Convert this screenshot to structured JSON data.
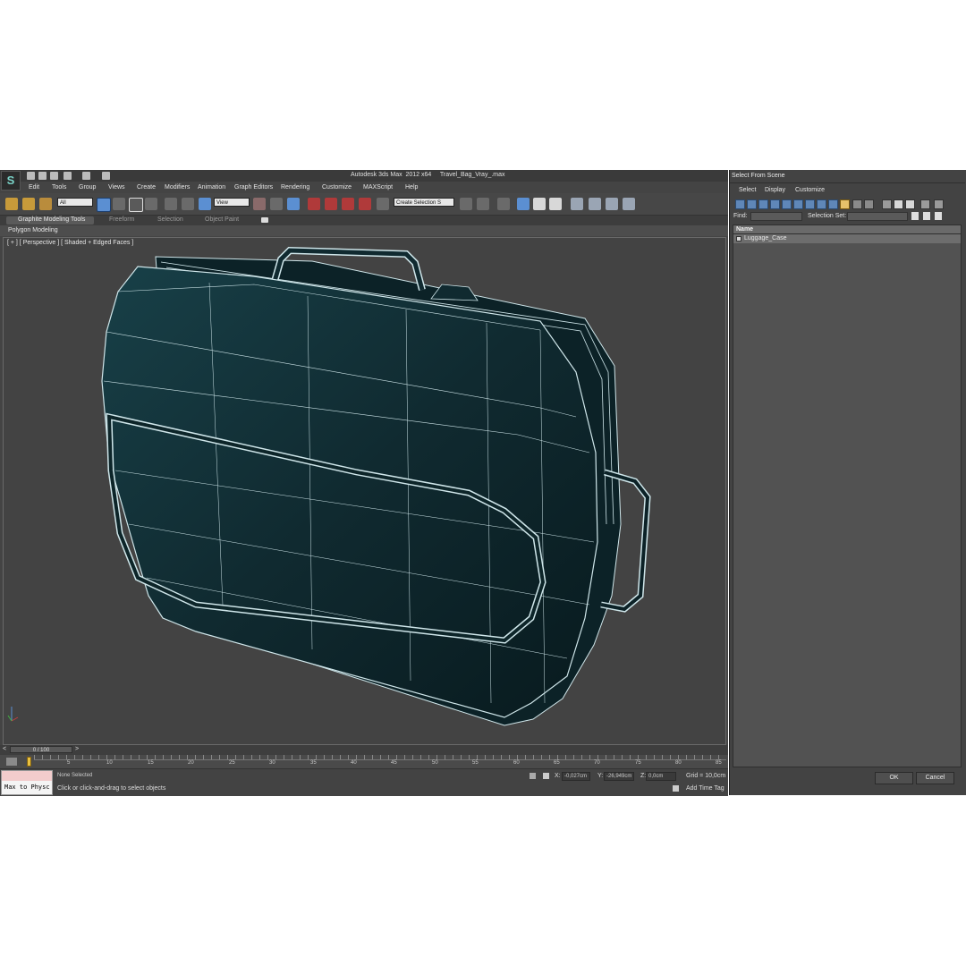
{
  "window": {
    "title": "Autodesk 3ds Max  2012 x64     Travel_Bag_Vray_.max",
    "logo_glyph": "S"
  },
  "menus": [
    "Edit",
    "Tools",
    "Group",
    "Views",
    "Create",
    "Modifiers",
    "Animation",
    "Graph Editors",
    "Rendering",
    "Customize",
    "MAXScript",
    "Help"
  ],
  "toolbar": {
    "filter_value": "All",
    "refcoord_value": "View",
    "selection_set_placeholder": "Create Selection S"
  },
  "ribbon": {
    "tabs": [
      "Graphite Modeling Tools",
      "Freeform",
      "Selection",
      "Object Paint"
    ],
    "panel_label": "Polygon Modeling"
  },
  "viewport": {
    "label": "[ + ] [ Perspective ] [ Shaded + Edged Faces ]",
    "body_color": "#143238",
    "edge_color": "#cfe6ea"
  },
  "timeline": {
    "frame": "0 / 100",
    "prev_arrow": "<",
    "next_arrow": ">",
    "ticks": [
      "5",
      "10",
      "15",
      "20",
      "25",
      "30",
      "35",
      "40",
      "45",
      "50",
      "55",
      "60",
      "65",
      "70",
      "75",
      "80",
      "85"
    ]
  },
  "status": {
    "maxscript": "Max to Physc",
    "selection": "None Selected",
    "prompt": "Click or click-and-drag to select objects",
    "x_label": "X:",
    "x_value": "-0,027cm",
    "y_label": "Y:",
    "y_value": "-26,949cm",
    "z_label": "Z:",
    "z_value": "0,0cm",
    "grid": "Grid = 10,0cm",
    "add_time_tag": "Add Time Tag"
  },
  "select_from_scene": {
    "title": "Select From Scene",
    "menus": [
      "Select",
      "Display",
      "Customize"
    ],
    "find_label": "Find:",
    "selection_sets_label": "Selection Set:",
    "column_name": "Name",
    "items": [
      "Luggage_Case"
    ],
    "ok": "OK",
    "cancel": "Cancel"
  }
}
